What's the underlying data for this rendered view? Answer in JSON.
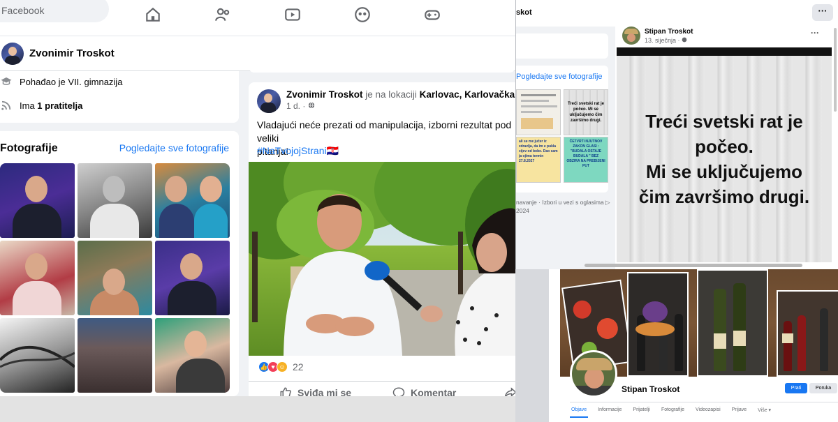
{
  "left": {
    "nav": {
      "search_text": "Facebook"
    },
    "profile": {
      "name": "Zvonimir Troskot"
    },
    "intro": {
      "school": "Pohađao je VII. gimnazija",
      "followers_prefix": "Ima ",
      "followers_count": "1 pratitelja"
    },
    "photos": {
      "title": "Fotografije",
      "see_all": "Pogledajte sve fotografije"
    },
    "post": {
      "author": "Zvonimir Troskot",
      "location_prefix": " je na lokaciji ",
      "location": "Karlovac, Karlovačka žup",
      "meta": "1 d. · ",
      "text": "Vladajući neće prezati od manipulacija, izborni rezultat pod veliki\npitanja!",
      "hashtag": "#NaTvojojStrani🇭🇷",
      "reaction_count": "22",
      "like_label": "Sviđa mi se",
      "comment_label": "Komentar"
    }
  },
  "right": {
    "window_title": "skot",
    "more_label": "···",
    "photos_link": "Pogledajte sve fotografije",
    "thumb_text_1": "Treći svetski rat je počeo. Mi se uključujemo čim završimo drugi.",
    "thumb_text_2": "ali se me jučer iz zdravlja, da im e pukla cijev od bobe. Dao sam ja ojima termin 27.8.2027",
    "thumb_text_3": "ČETVRTI NJUTNOV ZAKON GLASI : \"BUDALA OSTAJE BUDALA \" BEZ OBZIRA NA PREBIJENI PUT",
    "footer_line_1": "navanje · Izbori u vezi s oglasima ▷",
    "footer_line_2": "2024",
    "post": {
      "author": "Stipan Troskot",
      "date": "13. siječnja · ",
      "more": "···",
      "meme_line_1": "Treći svetski rat je",
      "meme_line_2": "počeo.",
      "meme_line_3": "Mi se uključujemo",
      "meme_line_4": "čim završimo drugi."
    }
  },
  "bottom_right": {
    "name": "Stipan Troskot",
    "follow": "Prati",
    "message": "Poruka",
    "tabs": [
      "Objave",
      "Informacije",
      "Prijatelji",
      "Fotografije",
      "Videozapisi",
      "Prijave",
      "Više ▾"
    ]
  },
  "colors": {
    "accent": "#1877f2",
    "text": "#050505",
    "muted": "#65676b",
    "background": "#f0f2f5"
  }
}
